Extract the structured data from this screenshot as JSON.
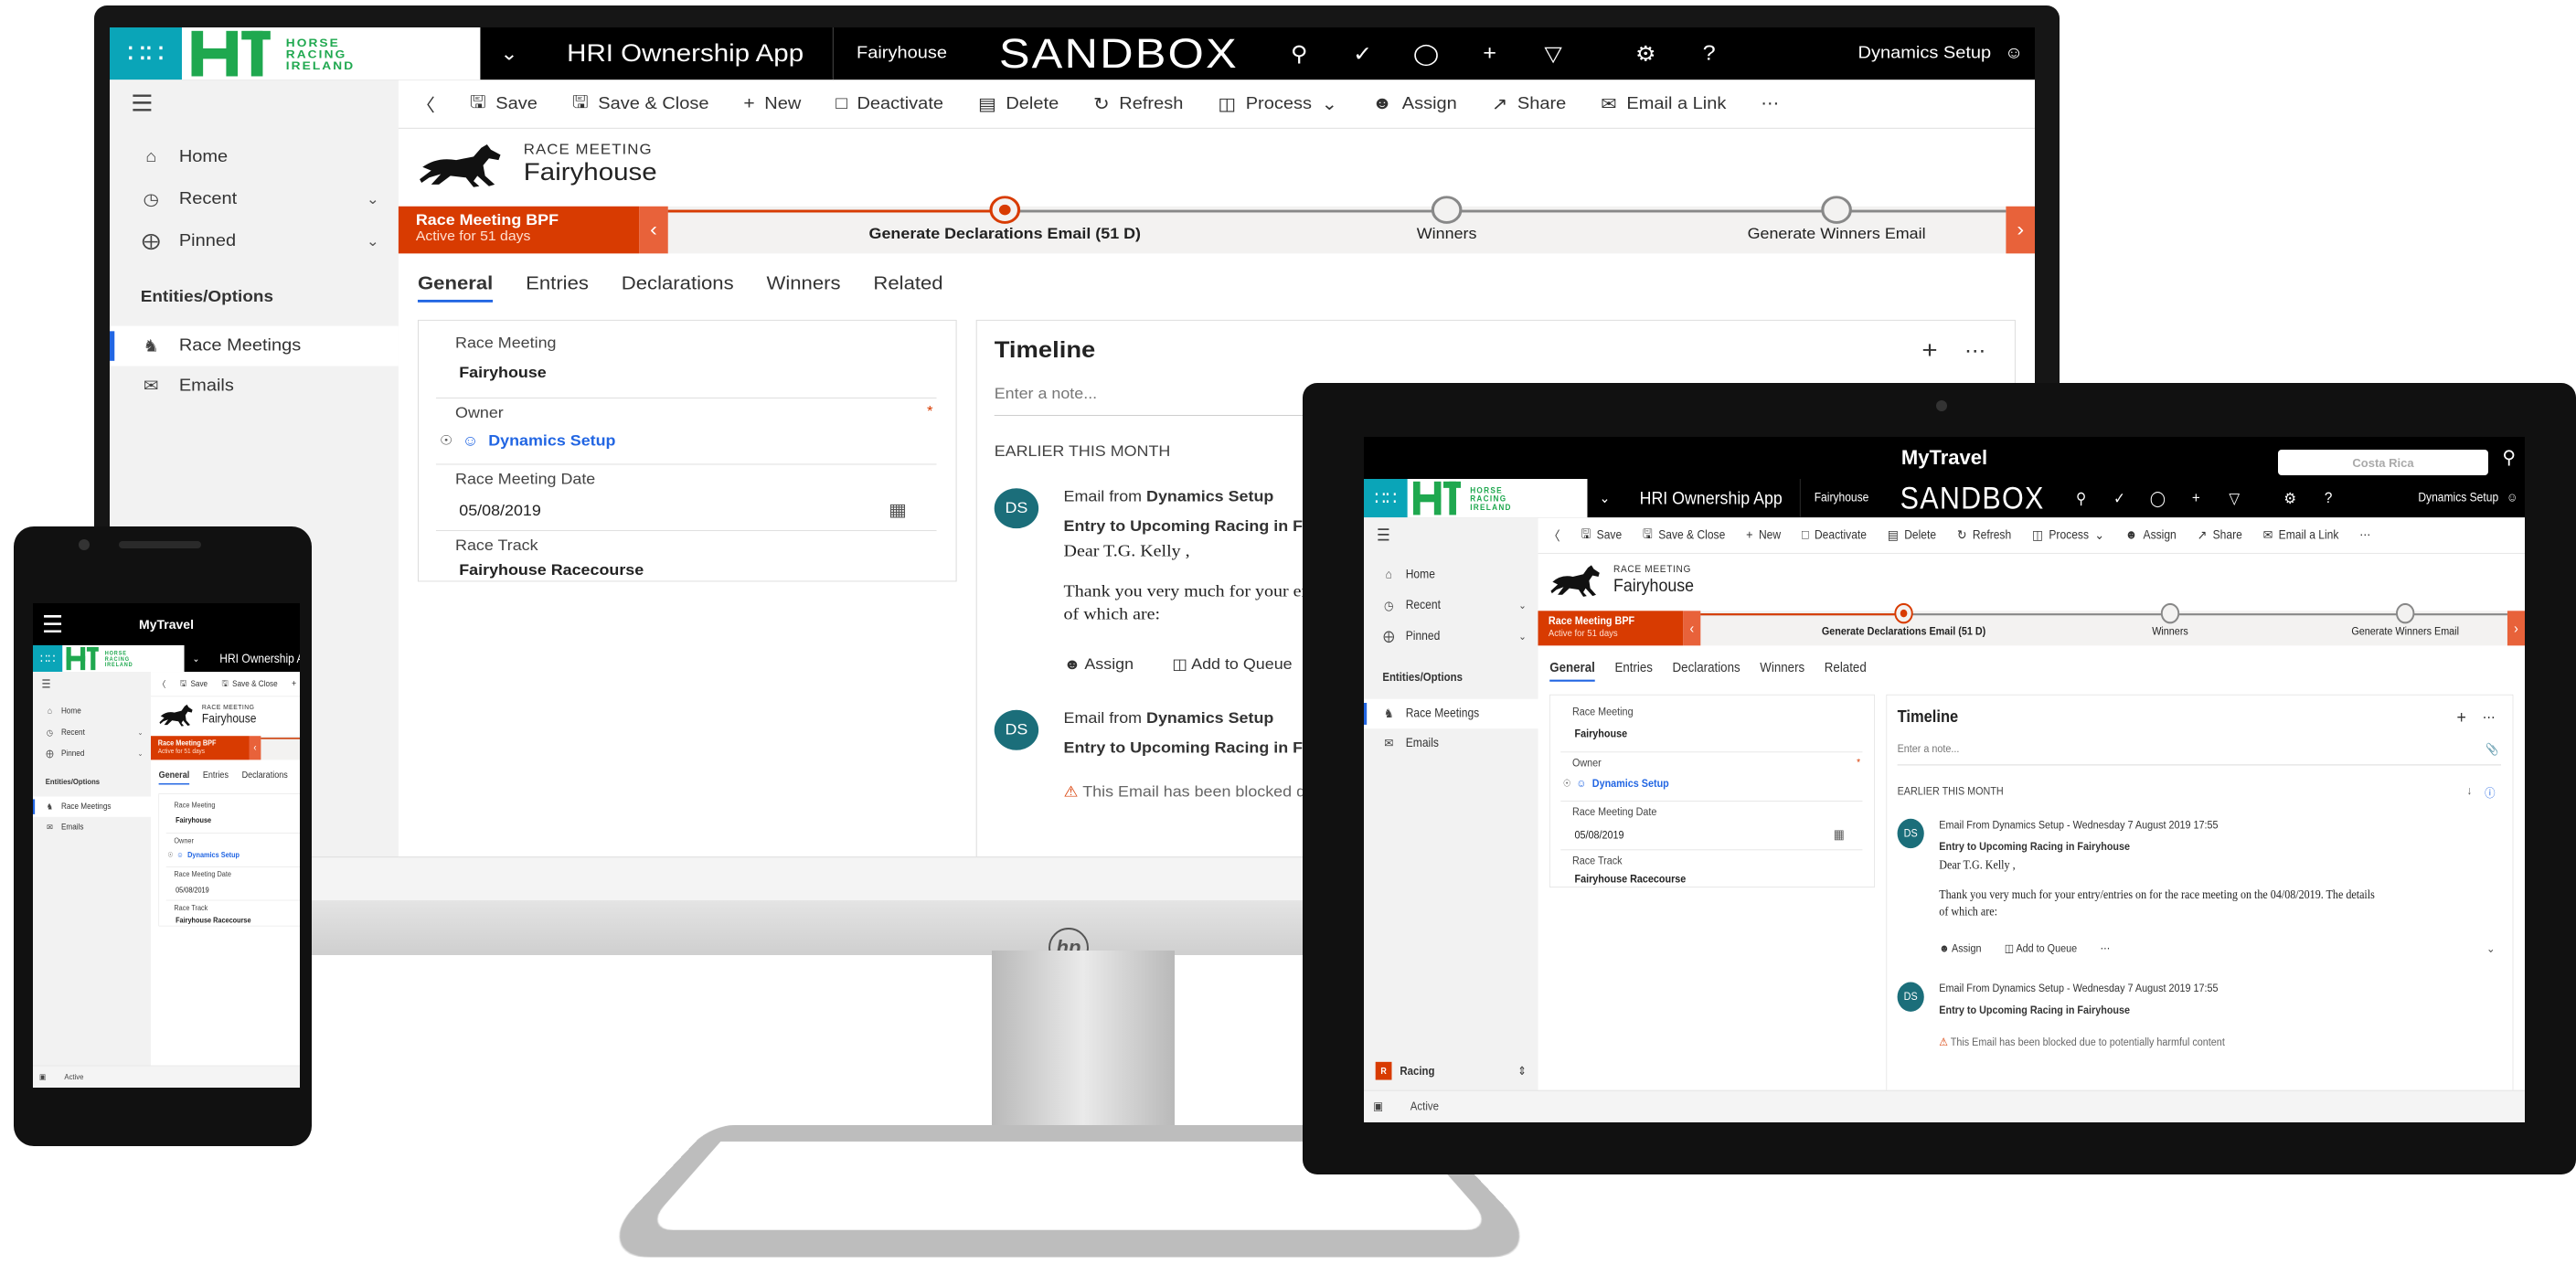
{
  "monitor_app": {
    "brand_lines": [
      "HORSE",
      "RACING",
      "IRELAND"
    ],
    "app_name": "HRI Ownership App",
    "environment": "Fairyhouse",
    "sandbox": "SANDBOX",
    "user": "Dynamics Setup",
    "commands": [
      "Save",
      "Save & Close",
      "New",
      "Deactivate",
      "Delete",
      "Refresh",
      "Process",
      "Assign",
      "Share",
      "Email a Link",
      "⋯"
    ],
    "sidebar": {
      "home": "Home",
      "recent": "Recent",
      "pinned": "Pinned",
      "section": "Entities/Options",
      "race_meetings": "Race Meetings",
      "emails": "Emails"
    },
    "record": {
      "type": "RACE MEETING",
      "name": "Fairyhouse"
    },
    "bpf": {
      "stage_name": "Race Meeting BPF",
      "stage_status": "Active for 51 days",
      "stages": [
        "Generate Declarations Email  (51 D)",
        "Winners",
        "Generate Winners Email"
      ]
    },
    "tabs": [
      "General",
      "Entries",
      "Declarations",
      "Winners",
      "Related"
    ],
    "form": {
      "race_meeting_label": "Race Meeting",
      "race_meeting_value": "Fairyhouse",
      "owner_label": "Owner",
      "owner_value": "Dynamics Setup",
      "date_label": "Race Meeting Date",
      "date_value": "05/08/2019",
      "track_label": "Race Track",
      "track_value": "Fairyhouse Racecourse"
    },
    "timeline": {
      "title": "Timeline",
      "note_placeholder": "Enter a note...",
      "section": "EARLIER THIS MONTH",
      "avatar": "DS",
      "post1_prefix": "Email from ",
      "post1_author": "Dynamics Setup",
      "post1_subject": "Entry to Upcoming Racing in Fairyhouse",
      "post1_greeting": "Dear T.G. Kelly ,",
      "post1_body1": "Thank you very much for your entry/entries on for the race meeting on the 04/08/2019. The details",
      "post1_body2": "of which are:",
      "assign": "Assign",
      "add_to_queue": "Add to Queue",
      "post2_prefix": "Email from ",
      "post2_author": "Dynamics Setup",
      "post2_subject": "Entry to Upcoming Racing in Fairyhouse",
      "blocked": "This Email has been blocked due to potentially harmful content"
    },
    "status": "Active"
  },
  "tablet": {
    "bar_title": "MyTravel",
    "search_placeholder": "Costa Rica",
    "area": "Racing",
    "post_meta": "Email From Dynamics Setup - Wednesday 7 August 2019 17:55",
    "post_meta2": "Email From Dynamics Setup - Wednesday 7 August 2019 17:55",
    "dot_menu": "⋯"
  },
  "phone": {
    "bar_title": "MyTravel"
  },
  "hp_logo": "hp"
}
